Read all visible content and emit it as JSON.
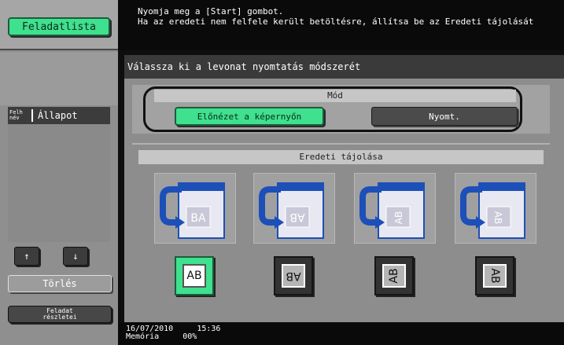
{
  "left_panel": {
    "job_list_button": "Feladatlista",
    "header_user": "Felh név",
    "header_status": "Állapot",
    "up_arrow": "↑",
    "down_arrow": "↓",
    "delete_button": "Törlés",
    "job_details_line1": "Feladat",
    "job_details_line2": "részletei"
  },
  "message": {
    "line1": "Nyomja meg a [Start] gombot.",
    "line2": "Ha az eredeti nem felfele került betöltésre, állítsa be az Eredeti tájolását"
  },
  "main": {
    "title": "Válassza ki a levonat nyomtatás módszerét",
    "mode_label": "Mód",
    "preview_button": "Előnézet a képernyőn",
    "print_button": "Nyomt.",
    "orientation_label": "Eredeti tájolása",
    "orientation_options": [
      {
        "label": "AB",
        "icon": "orientation-upright-icon",
        "selected": true
      },
      {
        "label": "AB",
        "icon": "orientation-upside-down-icon",
        "selected": false
      },
      {
        "label": "AB",
        "icon": "orientation-rotate-left-icon",
        "selected": false
      },
      {
        "label": "AB",
        "icon": "orientation-rotate-right-icon",
        "selected": false
      }
    ]
  },
  "status_bar": {
    "date": "16/07/2010",
    "time": "15:36",
    "memory_label": "Memória",
    "memory_value": "00%"
  },
  "colors": {
    "accent_green": "#3fe08e",
    "panel_gray": "#8d8d8d",
    "dark": "#0a0a0a",
    "thumb_blue": "#1d4fb8"
  }
}
